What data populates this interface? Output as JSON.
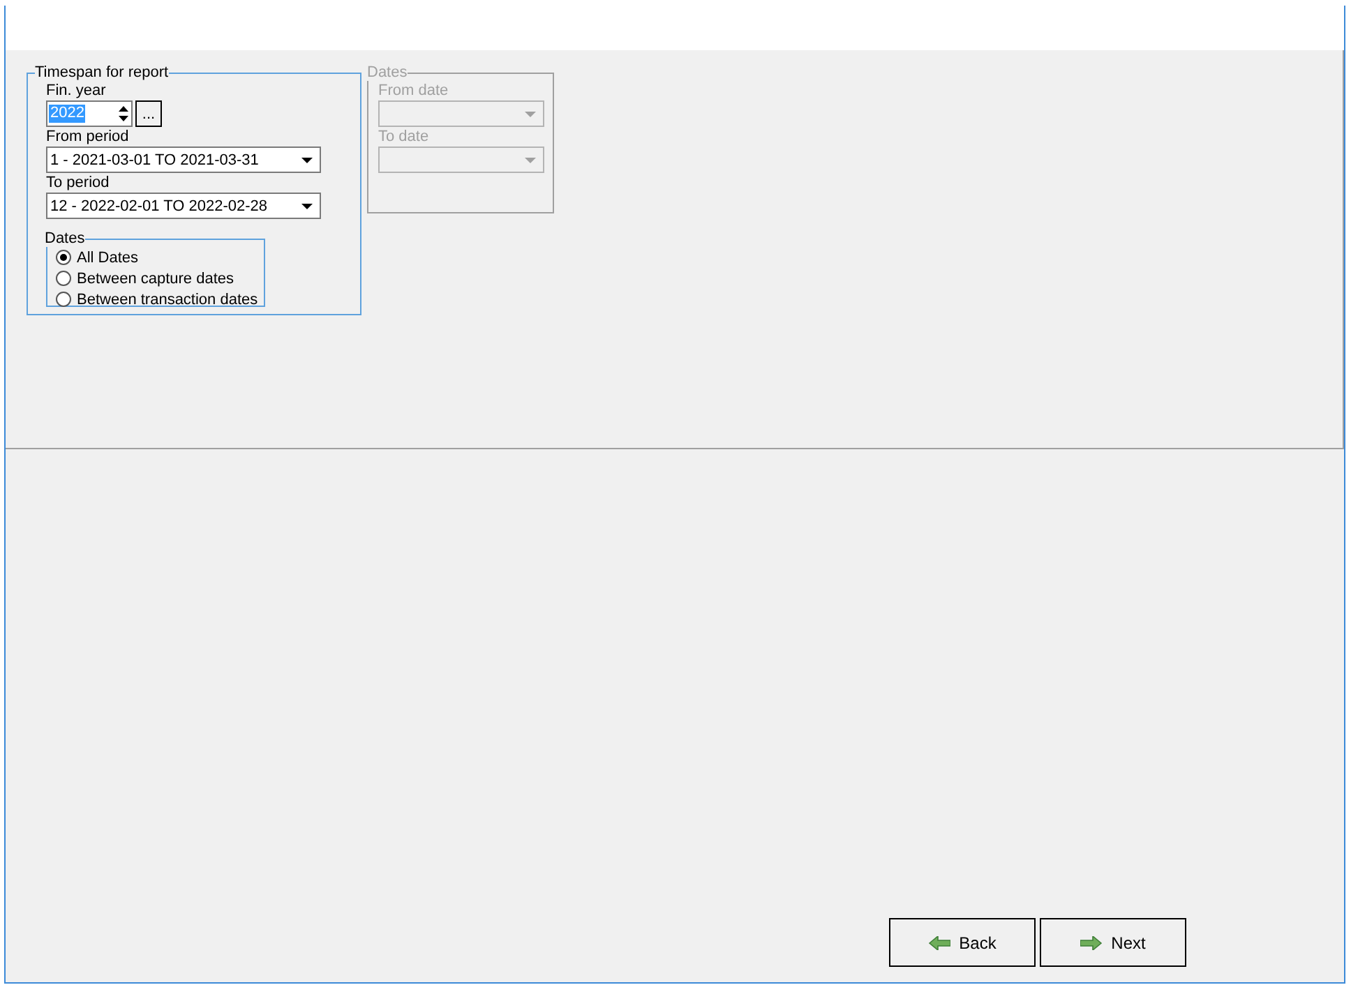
{
  "timespan": {
    "title": "Timespan for report",
    "fin_year": {
      "label": "Fin. year",
      "value": "2022",
      "text_selected": true,
      "browse": "..."
    },
    "from_period": {
      "label": "From period",
      "value": "1  - 2021-03-01 TO 2021-03-31"
    },
    "to_period": {
      "label": "To period",
      "value": "12 - 2022-02-01 TO 2022-02-28"
    },
    "dates": {
      "title": "Dates",
      "options": [
        {
          "label": "All Dates",
          "selected": true
        },
        {
          "label": "Between capture dates",
          "selected": false
        },
        {
          "label": "Between transaction dates",
          "selected": false
        }
      ]
    }
  },
  "date_range": {
    "title": "Dates",
    "disabled": true,
    "from_date": {
      "label": "From date"
    },
    "to_date": {
      "label": "To date"
    }
  },
  "buttons": [
    {
      "label": "Back",
      "kind": "back"
    },
    {
      "label": "Next",
      "kind": "next"
    }
  ]
}
